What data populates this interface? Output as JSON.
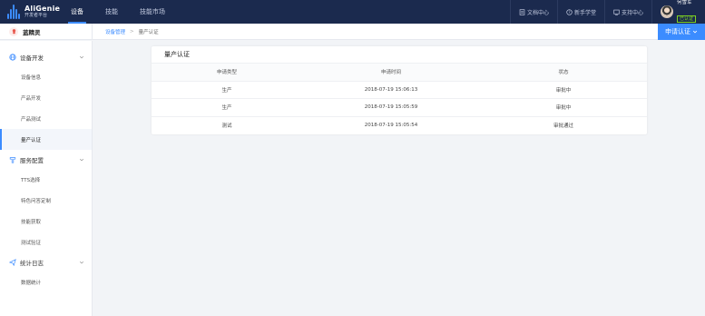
{
  "app": {
    "logo_name": "AliGenie",
    "logo_sub": "开发者平台"
  },
  "topnav": {
    "tabs": [
      {
        "label": "设备",
        "active": true
      },
      {
        "label": "技能",
        "active": false
      },
      {
        "label": "技能市场",
        "active": false
      }
    ],
    "links": [
      {
        "label": "文档中心",
        "icon": "document-icon"
      },
      {
        "label": "新手学堂",
        "icon": "question-icon"
      },
      {
        "label": "支持中心",
        "icon": "support-icon"
      }
    ],
    "user": {
      "name": "何雪军",
      "badge": "已认证"
    }
  },
  "subbar": {
    "device_name": "蓝精灵",
    "breadcrumb": [
      "设备管理",
      "量产认证"
    ],
    "apply_button": "申请认证"
  },
  "sidebar": {
    "groups": [
      {
        "label": "设备开发",
        "icon": "globe-icon",
        "items": [
          {
            "label": "设备信息",
            "active": false
          },
          {
            "label": "产品开发",
            "active": false
          },
          {
            "label": "产品测试",
            "active": false
          },
          {
            "label": "量产认证",
            "active": true
          }
        ]
      },
      {
        "label": "服务配置",
        "icon": "service-icon",
        "items": [
          {
            "label": "TTS选择",
            "active": false
          },
          {
            "label": "特色问答定制",
            "active": false
          },
          {
            "label": "技能获取",
            "active": false
          },
          {
            "label": "测试验证",
            "active": false
          }
        ]
      },
      {
        "label": "统计日志",
        "icon": "send-icon",
        "items": [
          {
            "label": "数据统计",
            "active": false
          }
        ]
      }
    ]
  },
  "main": {
    "title": "量产认证",
    "columns": [
      "申请类型",
      "申请时间",
      "状态"
    ],
    "rows": [
      [
        "生产",
        "2018-07-19 15:06:13",
        "审批中"
      ],
      [
        "生产",
        "2018-07-19 15:05:59",
        "审批中"
      ],
      [
        "测试",
        "2018-07-19 15:05:54",
        "审批通过"
      ]
    ]
  },
  "colors": {
    "nav_bg": "#1b2a4e",
    "accent": "#3c8cff",
    "badge": "#7ed321"
  }
}
